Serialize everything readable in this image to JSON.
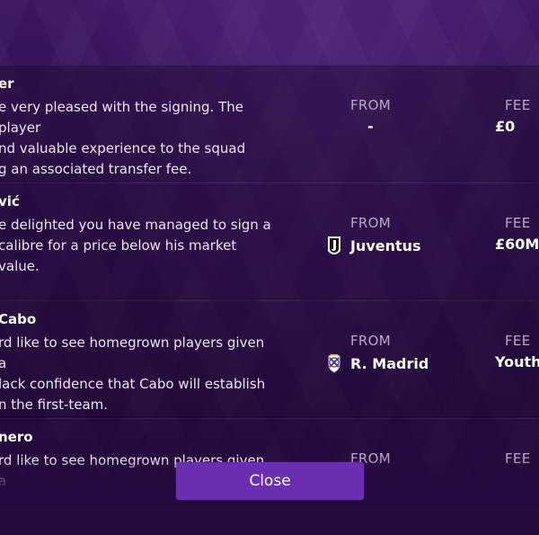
{
  "transfers": [
    {
      "name": "er",
      "description": "e very pleased with the signing. The player\nnd valuable experience to the squad\ng an associated transfer fee.",
      "from_label": "FROM",
      "from_value": "-",
      "fee_label": "FEE",
      "fee_value": "£0"
    },
    {
      "name": "vić",
      "description": "e delighted you have managed to sign a\ncalibre for a price below his market value.",
      "from_label": "FROM",
      "from_value": "Juventus",
      "from_icon": "juventus-crest-icon",
      "fee_label": "FEE",
      "fee_value": "£60M"
    },
    {
      "name": "Cabo",
      "description": "rd like to see homegrown players given a\nlack confidence that Cabo will establish\nn the first-team.",
      "from_label": "FROM",
      "from_value": "R. Madrid",
      "from_icon": "real-madrid-crest-icon",
      "fee_label": "FEE",
      "fee_value": "Youth"
    },
    {
      "name": "nero",
      "description": "rd like to see homegrown players given a",
      "from_label": "FROM",
      "fee_label": "FEE"
    }
  ],
  "footer": {
    "close_label": "Close"
  },
  "colors": {
    "accent": "#6a2fb0",
    "background": "#2a0f45",
    "label": "#b6a9c8"
  }
}
